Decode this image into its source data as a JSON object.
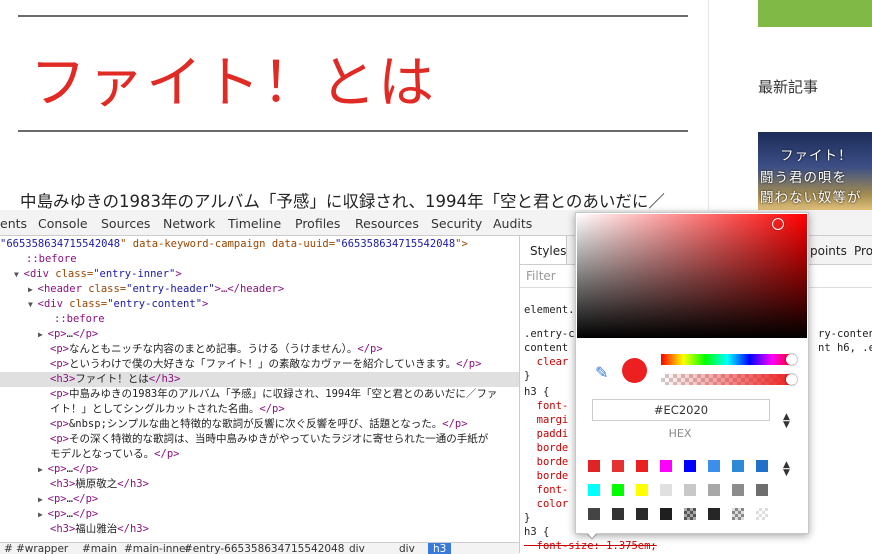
{
  "page": {
    "title": "ファイト！とは",
    "intro": "中島みゆきの1983年のアルバム「予感」に収録され、1994年「空と君とのあいだに／",
    "sidebar_heading": "最新記事",
    "thumb_lines": [
      "ファイト！",
      "闘う君の唄を",
      "闘わない奴等が"
    ]
  },
  "devtools": {
    "tabs": [
      "ents",
      "Console",
      "Sources",
      "Network",
      "Timeline",
      "Profiles",
      "Resources",
      "Security",
      "Audits"
    ],
    "dom_lines": [
      {
        "segs": [
          [
            "av",
            "\"665358634715542048"
          ],
          [
            "an",
            "\" data-keyword-campaign data-uuid="
          ],
          [
            "av",
            "\"665358634715542048"
          ],
          [
            "an",
            "\">"
          ]
        ]
      },
      {
        "segs": [
          [
            "pseudo",
            "::before"
          ]
        ]
      },
      {
        "segs": [
          [
            "tri",
            "▼ "
          ],
          [
            "tag",
            "<div "
          ],
          [
            "an",
            "class="
          ],
          [
            "av",
            "\"entry-inner\""
          ],
          [
            "tag",
            ">"
          ]
        ]
      },
      {
        "segs": [
          [
            "tri",
            "▶ "
          ],
          [
            "tag",
            "<header "
          ],
          [
            "an",
            "class="
          ],
          [
            "av",
            "\"entry-header\""
          ],
          [
            "tag",
            ">…</header>"
          ]
        ]
      },
      {
        "segs": [
          [
            "tri",
            "▼ "
          ],
          [
            "tag",
            "<div "
          ],
          [
            "an",
            "class="
          ],
          [
            "av",
            "\"entry-content\""
          ],
          [
            "tag",
            ">"
          ]
        ]
      },
      {
        "segs": [
          [
            "pseudo",
            "::before"
          ]
        ]
      },
      {
        "segs": [
          [
            "tri",
            "▶ "
          ],
          [
            "tag",
            "<p>"
          ],
          [
            "txt",
            "…"
          ],
          [
            "tag",
            "</p>"
          ]
        ]
      },
      {
        "segs": [
          [
            "tag",
            "<p>"
          ],
          [
            "txt",
            "なんともニッチな内容のまとめ記事。うける（うけません）。"
          ],
          [
            "tag",
            "</p>"
          ]
        ]
      },
      {
        "segs": [
          [
            "tag",
            "<p>"
          ],
          [
            "txt",
            "というわけで僕の大好きな「ファイト！」の素敵なカヴァーを紹介していきます。"
          ],
          [
            "tag",
            "</p>"
          ]
        ]
      },
      {
        "segs": [
          [
            "tag",
            "<h3>"
          ],
          [
            "txt",
            "ファイト！とは"
          ],
          [
            "tag",
            "</h3>"
          ]
        ]
      },
      {
        "segs": [
          [
            "tag",
            "<p>"
          ],
          [
            "txt",
            "中島みゆきの1983年のアルバム「予感」に収録され、1994年「空と君とのあいだに／ファ"
          ]
        ]
      },
      {
        "segs": [
          [
            "txt",
            "イト！」としてシングルカットされた名曲。"
          ],
          [
            "tag",
            "</p>"
          ]
        ]
      },
      {
        "segs": [
          [
            "tag",
            "<p>"
          ],
          [
            "txt",
            "&nbsp;シンプルな曲と特徴的な歌詞が反響に次ぐ反響を呼び、話題となった。"
          ],
          [
            "tag",
            "</p>"
          ]
        ]
      },
      {
        "segs": [
          [
            "tag",
            "<p>"
          ],
          [
            "txt",
            "その深く特徴的な歌詞は、当時中島みゆきがやっていたラジオに寄せられた一通の手紙が"
          ]
        ]
      },
      {
        "segs": [
          [
            "txt",
            "モデルとなっている。"
          ],
          [
            "tag",
            "</p>"
          ]
        ]
      },
      {
        "segs": [
          [
            "tri",
            "▶ "
          ],
          [
            "tag",
            "<p>"
          ],
          [
            "txt",
            "…"
          ],
          [
            "tag",
            "</p>"
          ]
        ]
      },
      {
        "segs": [
          [
            "tag",
            "<h3>"
          ],
          [
            "txt",
            "槇原敬之"
          ],
          [
            "tag",
            "</h3>"
          ]
        ]
      },
      {
        "segs": [
          [
            "tri",
            "▶ "
          ],
          [
            "tag",
            "<p>"
          ],
          [
            "txt",
            "…"
          ],
          [
            "tag",
            "</p>"
          ]
        ]
      },
      {
        "segs": [
          [
            "tri",
            "▶ "
          ],
          [
            "tag",
            "<p>"
          ],
          [
            "txt",
            "…"
          ],
          [
            "tag",
            "</p>"
          ]
        ]
      },
      {
        "segs": [
          [
            "tag",
            "<h3>"
          ],
          [
            "txt",
            "福山雅治"
          ],
          [
            "tag",
            "</h3>"
          ]
        ]
      }
    ],
    "selected_line": 9,
    "breadcrumbs": [
      "#",
      "#wrapper",
      "#main",
      "#main-inner",
      "#entry-665358634715542048",
      "div",
      "div",
      "h3"
    ],
    "styles_tabs": [
      "Styles",
      "points",
      "Pro"
    ],
    "filter_placeholder": "Filter",
    "style_lines": [
      "element.",
      ".entry-c",
      "content ",
      "  clear",
      "}",
      "h3 {",
      "  font-",
      "  margi",
      "  paddi",
      "  borde",
      "  borde",
      "  borde",
      "  font-",
      "  color",
      "}",
      "h3 {",
      "  font-size: 1.375em;"
    ],
    "style_right_lines": [
      "ry-content ",
      "nt h6, .en"
    ]
  },
  "picker": {
    "hex": "#EC2020",
    "format_label": "HEX",
    "color": "#ec2020",
    "palette": [
      "#e02424",
      "#e53131",
      "#ea1f1f",
      "#ff00ff",
      "#0000ff",
      "#3b8fe6",
      "#2e8ad6",
      "#2072c8",
      "#00ffff",
      "#00ff00",
      "#ffff00",
      "#e0e0e0",
      "#c8c8c8",
      "#a8a8a8",
      "#8c8c8c",
      "#6e6e6e",
      "#444444",
      "#333333",
      "#2a2a2a",
      "#1f1f1f",
      "checker",
      "#262626",
      "checker2",
      "checker3"
    ]
  }
}
